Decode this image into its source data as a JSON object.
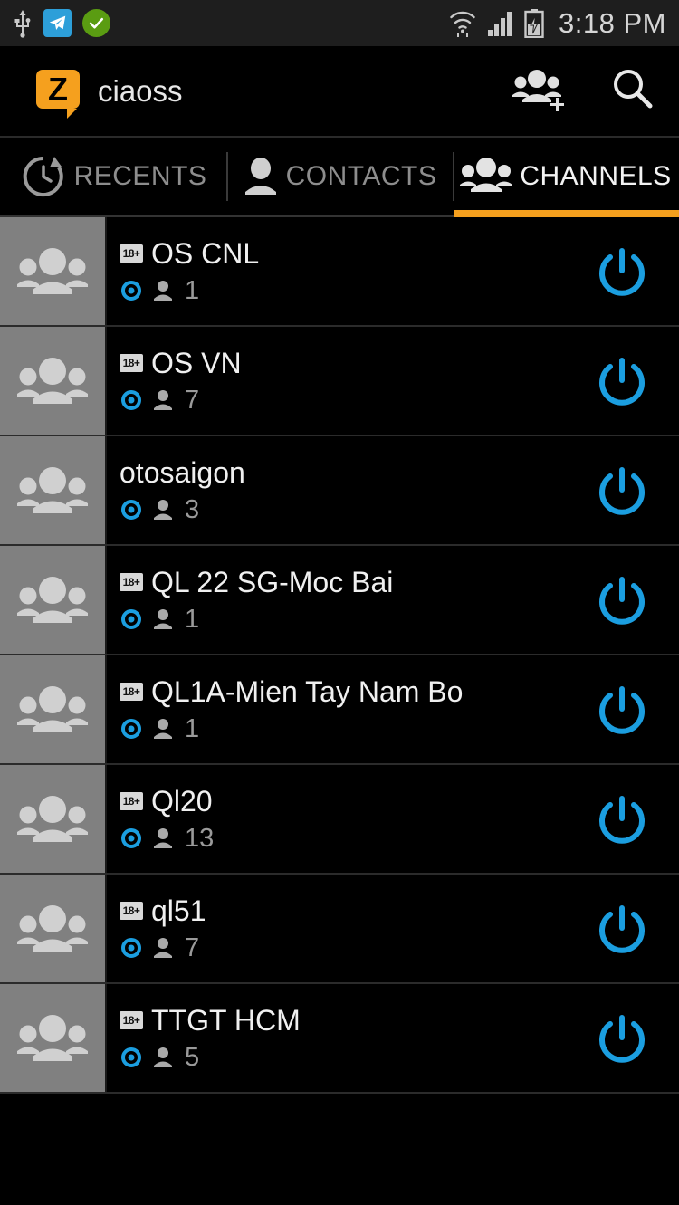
{
  "status_bar": {
    "time": "3:18 PM",
    "left_icons": [
      "usb-icon",
      "telegram-icon",
      "checkmark-icon"
    ],
    "right_icons": [
      "wifi-icon",
      "cellular-signal-icon",
      "battery-charging-icon"
    ]
  },
  "header": {
    "logo": "zello-logo",
    "logo_letter": "Z",
    "title": "ciaoss",
    "actions": [
      {
        "name": "add-channel-icon",
        "label": "Add channel"
      },
      {
        "name": "search-icon",
        "label": "Search"
      }
    ]
  },
  "tabs": [
    {
      "label": "RECENTS",
      "icon": "recents-clock-icon",
      "active": false
    },
    {
      "label": "CONTACTS",
      "icon": "contacts-person-icon",
      "active": false
    },
    {
      "label": "CHANNELS",
      "icon": "channels-group-icon",
      "active": true
    }
  ],
  "channels": [
    {
      "name": "OS CNL",
      "adult_badge": true,
      "badge_text": "18+",
      "status": "online",
      "users": "1"
    },
    {
      "name": "OS VN",
      "adult_badge": true,
      "badge_text": "18+",
      "status": "online",
      "users": "7"
    },
    {
      "name": "otosaigon",
      "adult_badge": false,
      "badge_text": "",
      "status": "online",
      "users": "3"
    },
    {
      "name": "QL 22 SG-Moc Bai",
      "adult_badge": true,
      "badge_text": "18+",
      "status": "online",
      "users": "1"
    },
    {
      "name": "QL1A-Mien Tay Nam Bo",
      "adult_badge": true,
      "badge_text": "18+",
      "status": "online",
      "users": "1"
    },
    {
      "name": "Ql20",
      "adult_badge": true,
      "badge_text": "18+",
      "status": "online",
      "users": "13"
    },
    {
      "name": "ql51",
      "adult_badge": true,
      "badge_text": "18+",
      "status": "online",
      "users": "7"
    },
    {
      "name": "TTGT HCM",
      "adult_badge": true,
      "badge_text": "18+",
      "status": "online",
      "users": "5"
    }
  ],
  "colors": {
    "accent_orange": "#F5A01E",
    "status_blue": "#1b9ee0",
    "background": "#000000",
    "avatar_gray": "#808080"
  }
}
